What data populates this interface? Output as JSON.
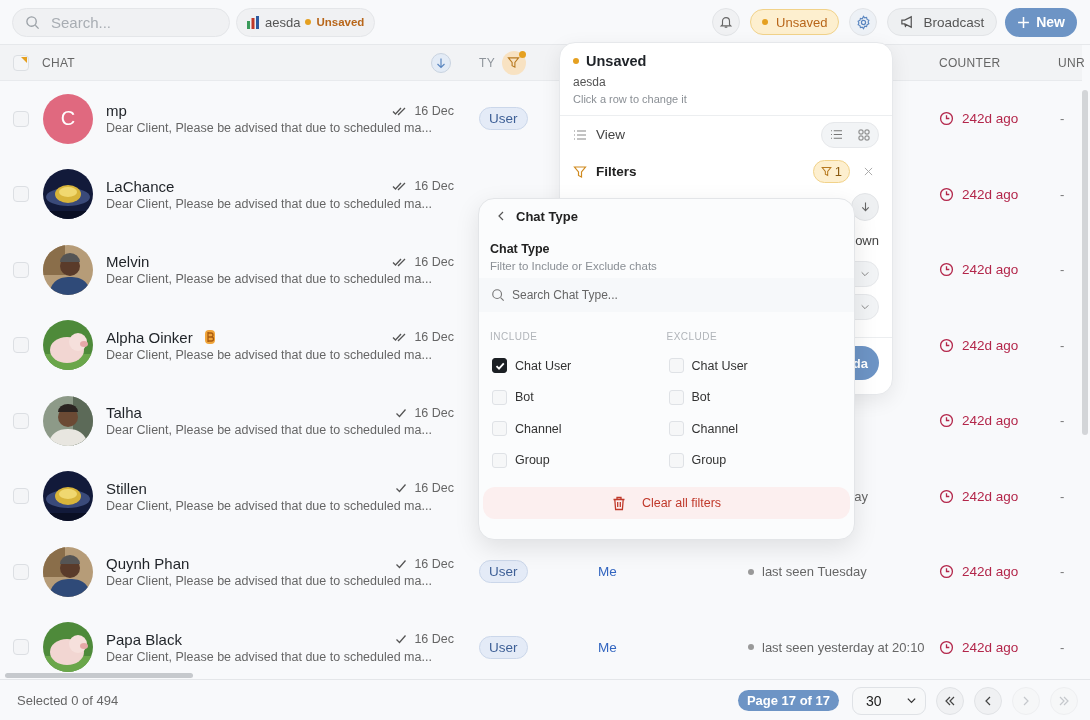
{
  "search": {
    "placeholder": "Search..."
  },
  "view_chip": {
    "name": "aesda",
    "status": "Unsaved"
  },
  "toolbar": {
    "status": "Unsaved",
    "broadcast": "Broadcast",
    "new": "New"
  },
  "table": {
    "select_all": {
      "partial": true
    },
    "columns": [
      {
        "label": "CHAT",
        "sorted": true
      },
      {
        "label": "TY",
        "filtered": true
      },
      {
        "label": "COUNTER"
      },
      {
        "label": "UNR"
      }
    ],
    "rows": [
      {
        "selected": false,
        "avatar": {
          "kind": "letter",
          "letter": "C",
          "color": "#e0697f"
        },
        "name": "mp",
        "read": true,
        "date": "16 Dec",
        "message": "Dear Client, Please be advised that due to scheduled ma...",
        "type": "User",
        "counter": "242d ago",
        "unread": "-"
      },
      {
        "selected": false,
        "name": "LaChance",
        "read": true,
        "date": "16 Dec",
        "message": "Dear Client, Please be advised that due to scheduled ma...",
        "counter": "242d ago",
        "unread": "-"
      },
      {
        "selected": false,
        "name": "Melvin",
        "read": true,
        "date": "16 Dec",
        "message": "Dear Client, Please be advised that due to scheduled ma...",
        "counter": "242d ago",
        "unread": "-"
      },
      {
        "selected": false,
        "name": "Alpha Oinker",
        "badge": true,
        "read": true,
        "date": "16 Dec",
        "message": "Dear Client, Please be advised that due to scheduled ma...",
        "counter": "242d ago",
        "unread": "-"
      },
      {
        "selected": false,
        "name": "Talha",
        "read": false,
        "date": "16 Dec",
        "message": "Dear Client, Please be advised that due to scheduled ma...",
        "counter": "242d ago",
        "unread": "-"
      },
      {
        "selected": false,
        "name": "Stillen",
        "read": false,
        "date": "16 Dec",
        "message": "Dear Client, Please be advised that due to scheduled ma...",
        "status": {
          "text": "ay",
          "clipped": true
        },
        "counter": "242d ago",
        "unread": "-"
      },
      {
        "selected": false,
        "name": "Quynh Phan",
        "read": false,
        "date": "16 Dec",
        "message": "Dear Client, Please be advised that due to scheduled ma...",
        "type": "User",
        "owner": "Me",
        "status": {
          "text": "last seen Tuesday",
          "clipped": false
        },
        "counter": "242d ago",
        "unread": "-"
      },
      {
        "selected": false,
        "name": "Papa Black",
        "read": false,
        "date": "16 Dec",
        "message": "Dear Client, Please be advised that due to scheduled ma...",
        "type": "User",
        "owner": "Me",
        "status": {
          "text": "last seen yesterday at 20:10",
          "clipped": false
        },
        "counter": "242d ago",
        "unread": "-"
      }
    ]
  },
  "view_popover": {
    "title": "Unsaved",
    "name": "aesda",
    "hint": "Click a row to change it",
    "view_label": "View",
    "view_options": [
      {
        "kind": "list",
        "selected": false
      },
      {
        "kind": "grid",
        "selected": false
      }
    ],
    "filters_label": "Filters",
    "filter_count": "1",
    "fragments": [
      {
        "kind": "sort"
      },
      {
        "kind": "text",
        "text": "own"
      },
      {
        "kind": "select"
      },
      {
        "kind": "select"
      },
      {
        "kind": "divider"
      },
      {
        "kind": "button",
        "text": "da"
      }
    ]
  },
  "filter_popover": {
    "title": "Chat Type",
    "heading": "Chat Type",
    "subtitle": "Filter to Include or Exclude chats",
    "search_placeholder": "Search Chat Type...",
    "include_label": "INCLUDE",
    "exclude_label": "EXCLUDE",
    "include": [
      {
        "label": "Chat User",
        "checked": true
      },
      {
        "label": "Bot",
        "checked": false
      },
      {
        "label": "Channel",
        "checked": false
      },
      {
        "label": "Group",
        "checked": false
      }
    ],
    "exclude": [
      {
        "label": "Chat User",
        "checked": false
      },
      {
        "label": "Bot",
        "checked": false
      },
      {
        "label": "Channel",
        "checked": false
      },
      {
        "label": "Group",
        "checked": false
      }
    ],
    "clear": "Clear all filters"
  },
  "footer": {
    "selected": "Selected 0 of 494",
    "page": "Page 17 of 17",
    "page_size": "30",
    "pager": [
      {
        "kind": "first",
        "disabled": false
      },
      {
        "kind": "prev",
        "disabled": false
      },
      {
        "kind": "next",
        "disabled": true
      },
      {
        "kind": "last",
        "disabled": true
      }
    ]
  }
}
